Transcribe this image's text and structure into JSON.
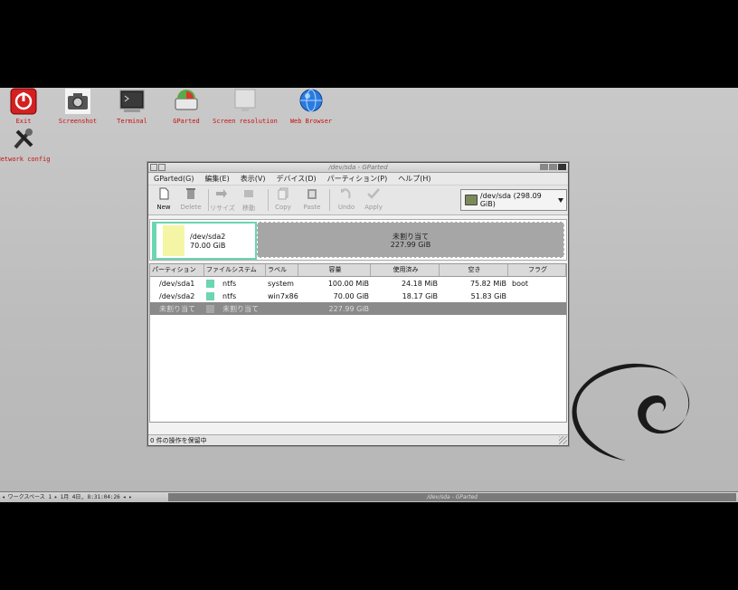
{
  "desktop": {
    "icons": [
      {
        "label": "Exit",
        "icon": "power-icon"
      },
      {
        "label": "Screenshot",
        "icon": "camera-icon"
      },
      {
        "label": "Terminal",
        "icon": "terminal-icon"
      },
      {
        "label": "GParted",
        "icon": "gparted-icon"
      },
      {
        "label": "Screen resolution",
        "icon": "monitor-icon"
      },
      {
        "label": "Web Browser",
        "icon": "globe-icon"
      },
      {
        "label": "Network config",
        "icon": "tools-icon"
      }
    ]
  },
  "window": {
    "title": "/dev/sda - GParted",
    "menu": [
      "GParted(G)",
      "編集(E)",
      "表示(V)",
      "デバイス(D)",
      "パーティション(P)",
      "ヘルプ(H)"
    ],
    "toolbar": {
      "new": "New",
      "delete": "Delete",
      "resize": "リサイズ",
      "move": "移動",
      "copy": "Copy",
      "paste": "Paste",
      "undo": "Undo",
      "apply": "Apply"
    },
    "device_selector": "/dev/sda  (298.09 GiB)",
    "map": {
      "seg1_name": "/dev/sda2",
      "seg1_size": "70.00 GiB",
      "seg2_name": "未割り当て",
      "seg2_size": "227.99 GiB"
    },
    "columns": [
      "パーティション",
      "ファイルシステム",
      "ラベル",
      "容量",
      "使用済み",
      "空き",
      "フラグ"
    ],
    "rows": [
      {
        "partition": "/dev/sda1",
        "fs": "ntfs",
        "label": "system",
        "size": "100.00 MiB",
        "used": "24.18 MiB",
        "free": "75.82 MiB",
        "flags": "boot"
      },
      {
        "partition": "/dev/sda2",
        "fs": "ntfs",
        "label": "win7x86",
        "size": "70.00 GiB",
        "used": "18.17 GiB",
        "free": "51.83 GiB",
        "flags": ""
      },
      {
        "partition": "未割り当て",
        "fs": "未割り当て",
        "label": "",
        "size": "227.99 GiB",
        "used": "",
        "free": "",
        "flags": ""
      }
    ],
    "status": "0 件の操作を保留中"
  },
  "taskbar": {
    "workspace": "ワークスペース 1",
    "clock": "1月 4日, 8:31:04:26",
    "task": "/dev/sda - GParted"
  },
  "colors": {
    "ntfs": "#6cd5b1",
    "unallocated": "#a6a6a6",
    "accent_label": "#c81010"
  }
}
